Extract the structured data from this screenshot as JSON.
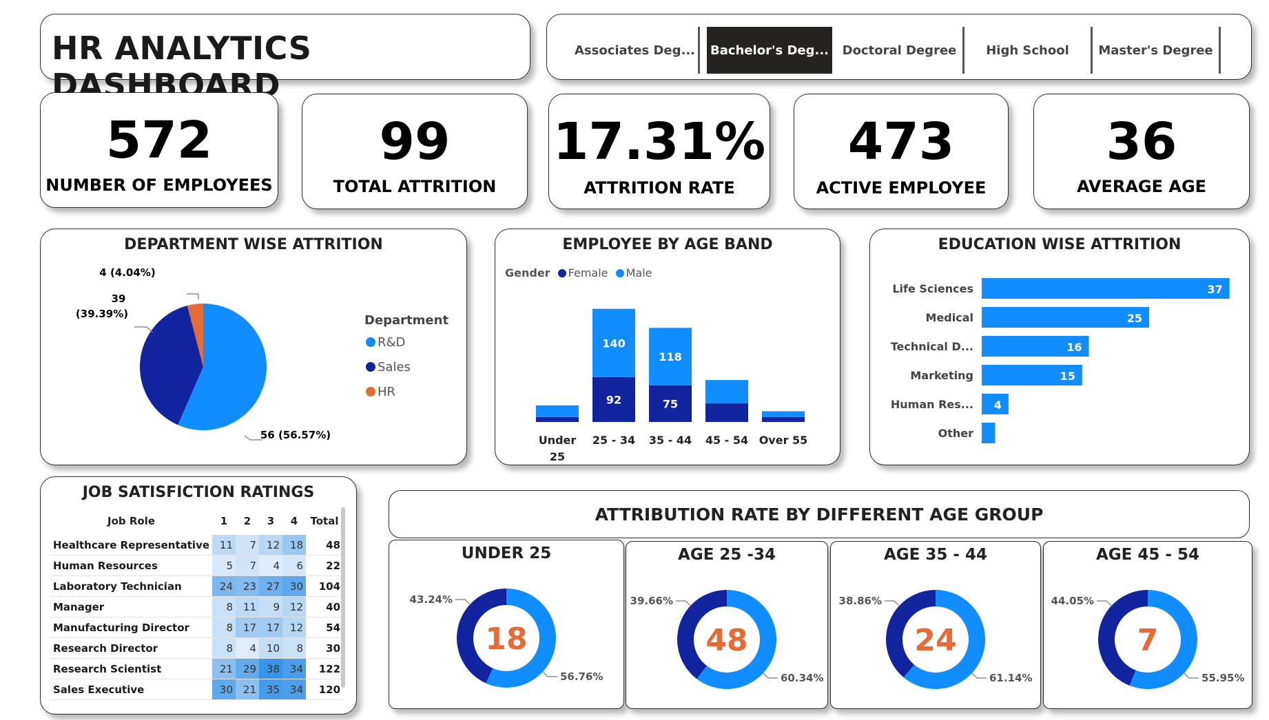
{
  "header": {
    "title": "HR ANALYTICS DASHBOARD",
    "education_slicer": [
      {
        "label": "Associates Deg...",
        "selected": false
      },
      {
        "label": "Bachelor's Deg...",
        "selected": true
      },
      {
        "label": "Doctoral Degree",
        "selected": false
      },
      {
        "label": "High School",
        "selected": false
      },
      {
        "label": "Master's Degree",
        "selected": false
      }
    ]
  },
  "kpis": [
    {
      "value": "572",
      "label": "NUMBER OF EMPLOYEES"
    },
    {
      "value": "99",
      "label": "TOTAL ATTRITION"
    },
    {
      "value": "17.31%",
      "label": "ATTRITION RATE"
    },
    {
      "value": "473",
      "label": "ACTIVE EMPLOYEE"
    },
    {
      "value": "36",
      "label": "AVERAGE AGE"
    }
  ],
  "colors": {
    "light_blue": "#118dff",
    "dark_blue": "#12239e",
    "orange": "#e66c37",
    "donut_center_text": "#e66c37"
  },
  "chart_data": [
    {
      "type": "pie",
      "title": "DEPARTMENT WISE ATTRITION",
      "legend_title": "Department",
      "legend_placement": "right",
      "slices": [
        {
          "name": "R&D",
          "value": 56,
          "label": "56 (56.57%)",
          "color": "#118dff"
        },
        {
          "name": "Sales",
          "value": 39,
          "label": "39 (39.39%)",
          "color": "#12239e"
        },
        {
          "name": "HR",
          "value": 4,
          "label": "4 (4.04%)",
          "color": "#e66c37"
        }
      ]
    },
    {
      "type": "bar",
      "stacked": true,
      "title": "EMPLOYEE BY AGE BAND",
      "legend_title": "Gender",
      "legend_placement": "top-left",
      "categories": [
        "Under 25",
        "25 - 34",
        "35 - 44",
        "45 - 54",
        "Over 55"
      ],
      "series": [
        {
          "name": "Female",
          "color": "#12239e",
          "values": [
            10,
            92,
            75,
            38,
            10
          ],
          "labels": [
            "",
            "92",
            "75",
            "",
            ""
          ]
        },
        {
          "name": "Male",
          "color": "#118dff",
          "values": [
            24,
            140,
            118,
            48,
            12
          ],
          "labels": [
            "",
            "140",
            "118",
            "",
            ""
          ]
        }
      ],
      "ylim": [
        0,
        240
      ]
    },
    {
      "type": "bar",
      "orientation": "horizontal",
      "title": "EDUCATION WISE ATTRITION",
      "categories": [
        "Life Sciences",
        "Medical",
        "Technical D...",
        "Marketing",
        "Human Res...",
        "Other"
      ],
      "values": [
        37,
        25,
        16,
        15,
        4,
        2
      ],
      "labels": [
        "37",
        "25",
        "16",
        "15",
        "4",
        ""
      ],
      "color": "#118dff",
      "xlim": [
        0,
        40
      ]
    },
    {
      "type": "table",
      "title": "JOB SATISFICTION RATINGS",
      "columns": [
        "Job Role",
        "1",
        "2",
        "3",
        "4",
        "Total"
      ],
      "rows": [
        {
          "role": "Healthcare Representative",
          "r1": 11,
          "r2": 7,
          "r3": 12,
          "r4": 18,
          "total": 48
        },
        {
          "role": "Human Resources",
          "r1": 5,
          "r2": 7,
          "r3": 4,
          "r4": 6,
          "total": 22
        },
        {
          "role": "Laboratory Technician",
          "r1": 24,
          "r2": 23,
          "r3": 27,
          "r4": 30,
          "total": 104
        },
        {
          "role": "Manager",
          "r1": 8,
          "r2": 11,
          "r3": 9,
          "r4": 12,
          "total": 40
        },
        {
          "role": "Manufacturing Director",
          "r1": 8,
          "r2": 17,
          "r3": 17,
          "r4": 12,
          "total": 54
        },
        {
          "role": "Research Director",
          "r1": 8,
          "r2": 4,
          "r3": 10,
          "r4": 8,
          "total": 30
        },
        {
          "role": "Research Scientist",
          "r1": 21,
          "r2": 29,
          "r3": 38,
          "r4": 34,
          "total": 122
        },
        {
          "role": "Sales Executive",
          "r1": 30,
          "r2": 21,
          "r3": 35,
          "r4": 34,
          "total": 120
        }
      ]
    }
  ],
  "age_group_section": {
    "title": "ATTRIBUTION RATE BY DIFFERENT AGE GROUP",
    "donuts": [
      {
        "title": "UNDER 25",
        "center": "18",
        "dark_pct": 43.24,
        "light_pct": 56.76,
        "dark_label": "43.24%",
        "light_label": "56.76%"
      },
      {
        "title": "AGE 25 -34",
        "center": "48",
        "dark_pct": 39.66,
        "light_pct": 60.34,
        "dark_label": "39.66%",
        "light_label": "60.34%"
      },
      {
        "title": "AGE 35 - 44",
        "center": "24",
        "dark_pct": 38.86,
        "light_pct": 61.14,
        "dark_label": "38.86%",
        "light_label": "61.14%"
      },
      {
        "title": "AGE 45 - 54",
        "center": "7",
        "dark_pct": 44.05,
        "light_pct": 55.95,
        "dark_label": "44.05%",
        "light_label": "55.95%"
      }
    ]
  }
}
